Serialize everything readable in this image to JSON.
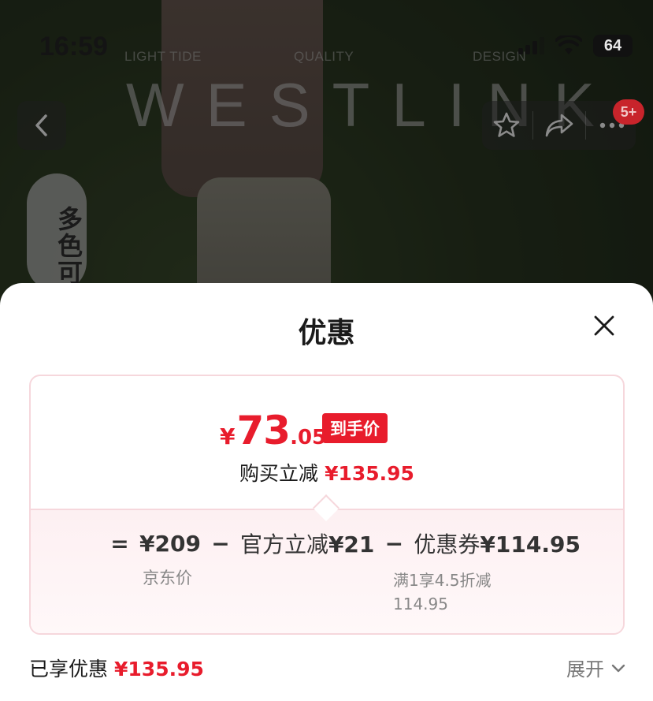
{
  "status_bar": {
    "time": "16:59",
    "battery": "64"
  },
  "background": {
    "brand_tags": [
      "LIGHT TIDE",
      "QUALITY",
      "DESIGN"
    ],
    "brand_logo": "WESTLINK",
    "color_pill": "多色可"
  },
  "nav": {
    "badge": "5+",
    "icons": [
      "back-icon",
      "star-icon",
      "share-icon",
      "more-icon"
    ]
  },
  "sheet": {
    "title": "优惠",
    "final_price": {
      "currency": "¥",
      "integer": "73",
      "decimal": ".05",
      "tag": "到手价"
    },
    "reduce": {
      "label": "购买立减",
      "amount": "¥135.95"
    },
    "formula": {
      "eq": "=",
      "base_amount": "¥209",
      "base_label": "京东价",
      "minus": "−",
      "official_label": "官方立减",
      "official_amount": "¥21",
      "coupon_label": "优惠券",
      "coupon_amount": "¥114.95",
      "coupon_detail_1": "满1享4.5折减",
      "coupon_detail_2": "114.95"
    },
    "enjoyed": {
      "label": "已享优惠",
      "amount": "¥135.95"
    },
    "expand_label": "展开"
  },
  "colors": {
    "accent_red": "#e81c2c",
    "card_border": "#f6d7dc",
    "card_bottom_bg": "#fdf0f2"
  }
}
